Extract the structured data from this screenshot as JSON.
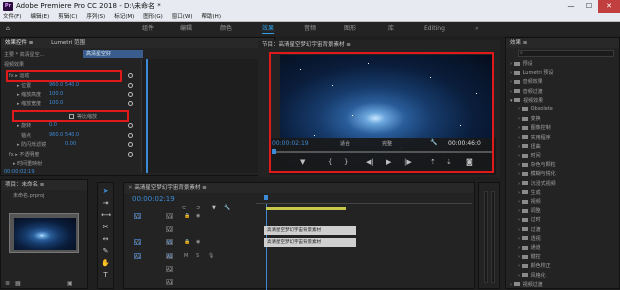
{
  "window": {
    "title": "Adobe Premiere Pro CC 2018 - D:\\未命名 *",
    "minimize": "—",
    "maximize": "☐",
    "close": "✕"
  },
  "menu": [
    "文件(F)",
    "编辑(E)",
    "剪辑(C)",
    "序列(S)",
    "标记(M)",
    "图形(G)",
    "窗口(W)",
    "帮助(H)"
  ],
  "workspaces": [
    "组件",
    "编辑",
    "颜色",
    "效果",
    "音频",
    "图形",
    "库",
    "Editing"
  ],
  "effect_controls": {
    "tabs": [
      "效果控件 ≡",
      "Lumetri 范围",
      "源：(无剪辑)",
      "音频"
    ],
    "master": "主要 * 高清星空...",
    "clip_tag": "高清星空好",
    "video_effects": "视频效果",
    "rows": [
      {
        "label": "fx  ▸ 运动"
      },
      {
        "label": "▸ 位置",
        "value": "960.0    540.0"
      },
      {
        "label": "▸ 缩放高度",
        "value": "100.0"
      },
      {
        "label": "▸ 缩放宽度",
        "value": "100.0"
      },
      {
        "label": "",
        "value": "等比缩放"
      },
      {
        "label": "▸ 旋转",
        "value": "0.0"
      },
      {
        "label": "锚点",
        "value": "960.0    540.0"
      },
      {
        "label": "▸ 防闪烁滤镜",
        "value": "0.00"
      },
      {
        "label": "fx  ▸ 不透明度"
      },
      {
        "label": "▸ 时间重映射"
      }
    ],
    "timecode": "00:00:02:19"
  },
  "program": {
    "title": "节目：高清星空梦幻宇宙背景素材 ≡",
    "timecode": "00:00:02:19",
    "fit": "适合",
    "quality": "完整",
    "duration": "00:00:46:0"
  },
  "effects": {
    "title": "效果 ≡",
    "items": [
      "预设",
      "Lumetri 预设",
      "音频效果",
      "音频过渡",
      "视频效果",
      "Obsolete",
      "变换",
      "图像控制",
      "实用程序",
      "扭曲",
      "时间",
      "杂色与颗粒",
      "模糊与锐化",
      "沉浸式视频",
      "生成",
      "视频",
      "调整",
      "过时",
      "过渡",
      "透视",
      "通道",
      "键控",
      "颜色校正",
      "风格化",
      "视频过渡"
    ]
  },
  "project": {
    "title": "项目：未命名 ≡",
    "file": "未命名.prproj"
  },
  "timeline": {
    "title": "高清星空梦幻宇宙背景素材 ≡",
    "timecode": "00:00:02:19",
    "clip": "高清星空梦幻宇宙背景素材",
    "tracks_video": [
      "V3",
      "V2",
      "V1"
    ],
    "tracks_audio": [
      "A1",
      "A2",
      "A3"
    ]
  }
}
